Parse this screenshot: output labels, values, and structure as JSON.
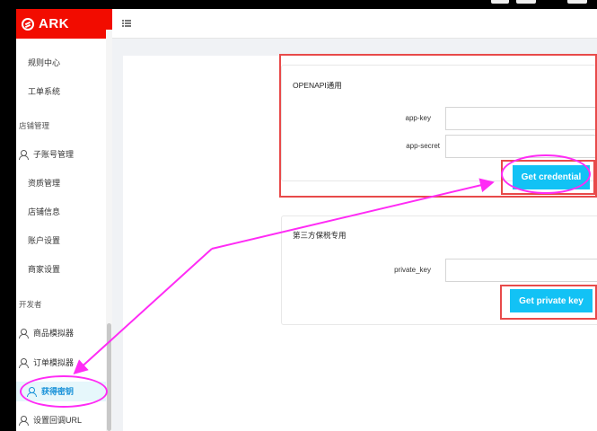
{
  "brand": {
    "name": "ARK"
  },
  "sidebar": {
    "items": [
      {
        "label": "规则中心",
        "kind": "sub"
      },
      {
        "label": "工单系统",
        "kind": "sub"
      },
      {
        "label": "店铺管理",
        "kind": "group"
      },
      {
        "label": "子账号管理",
        "kind": "icon"
      },
      {
        "label": "资质管理",
        "kind": "sub"
      },
      {
        "label": "店铺信息",
        "kind": "sub"
      },
      {
        "label": "账户设置",
        "kind": "sub"
      },
      {
        "label": "商家设置",
        "kind": "sub"
      },
      {
        "label": "开发者",
        "kind": "group"
      },
      {
        "label": "商品模拟器",
        "kind": "icon"
      },
      {
        "label": "订单模拟器",
        "kind": "icon"
      },
      {
        "label": "获得密钥",
        "kind": "icon",
        "active": true
      },
      {
        "label": "设置回调URL",
        "kind": "icon"
      }
    ]
  },
  "openapi": {
    "title": "OPENAPI通用",
    "app_key_label": "app-key",
    "app_key_value": "",
    "app_secret_label": "app-secret",
    "app_secret_value": "",
    "button_label": "Get credential"
  },
  "bonded": {
    "title": "第三方保税专用",
    "private_key_label": "private_key",
    "private_key_value": "",
    "button_label": "Get private key"
  },
  "colors": {
    "brand_red": "#f20c00",
    "button_blue": "#12c2f5",
    "annotation_red": "#e84a4a",
    "annotation_magenta": "#ff2bf5",
    "active_text": "#1590d8"
  }
}
